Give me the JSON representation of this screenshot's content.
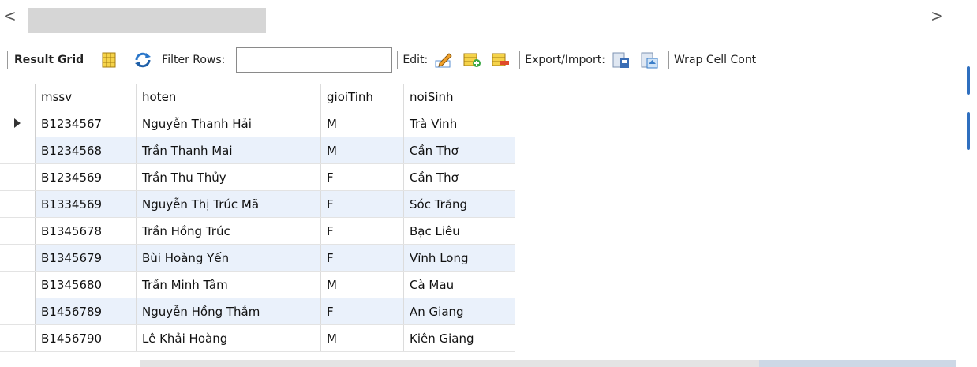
{
  "scrollbar": {
    "left_arrow": "<",
    "right_arrow": ">"
  },
  "toolbar": {
    "result_grid_label": "Result Grid",
    "filter_label": "Filter Rows:",
    "filter_value": "",
    "edit_label": "Edit:",
    "export_label": "Export/Import:",
    "wrap_label": "Wrap Cell Cont"
  },
  "grid": {
    "columns": [
      "mssv",
      "hoten",
      "gioiTinh",
      "noiSinh"
    ],
    "rows": [
      {
        "mssv": "B1234567",
        "hoten": "Nguyễn Thanh Hải",
        "gioiTinh": "M",
        "noiSinh": "Trà Vinh"
      },
      {
        "mssv": "B1234568",
        "hoten": "Trần Thanh Mai",
        "gioiTinh": "M",
        "noiSinh": "Cần Thơ"
      },
      {
        "mssv": "B1234569",
        "hoten": "Trần Thu Thủy",
        "gioiTinh": "F",
        "noiSinh": "Cần Thơ"
      },
      {
        "mssv": "B1334569",
        "hoten": "Nguyễn Thị Trúc Mã",
        "gioiTinh": "F",
        "noiSinh": "Sóc Trăng"
      },
      {
        "mssv": "B1345678",
        "hoten": "Trần Hồng Trúc",
        "gioiTinh": "F",
        "noiSinh": "Bạc Liêu"
      },
      {
        "mssv": "B1345679",
        "hoten": "Bùi Hoàng Yến",
        "gioiTinh": "F",
        "noiSinh": "Vĩnh Long"
      },
      {
        "mssv": "B1345680",
        "hoten": "Trần Minh Tâm",
        "gioiTinh": "M",
        "noiSinh": "Cà Mau"
      },
      {
        "mssv": "B1456789",
        "hoten": "Nguyễn Hồng Thắm",
        "gioiTinh": "F",
        "noiSinh": "An Giang"
      },
      {
        "mssv": "B1456790",
        "hoten": "Lê Khải Hoàng",
        "gioiTinh": "M",
        "noiSinh": "Kiên Giang"
      }
    ]
  },
  "icons": [
    "grid-layout-icon",
    "refresh-icon",
    "edit-pencil-icon",
    "add-row-icon",
    "delete-row-icon",
    "export-icon",
    "import-icon",
    "row-cursor-icon"
  ]
}
